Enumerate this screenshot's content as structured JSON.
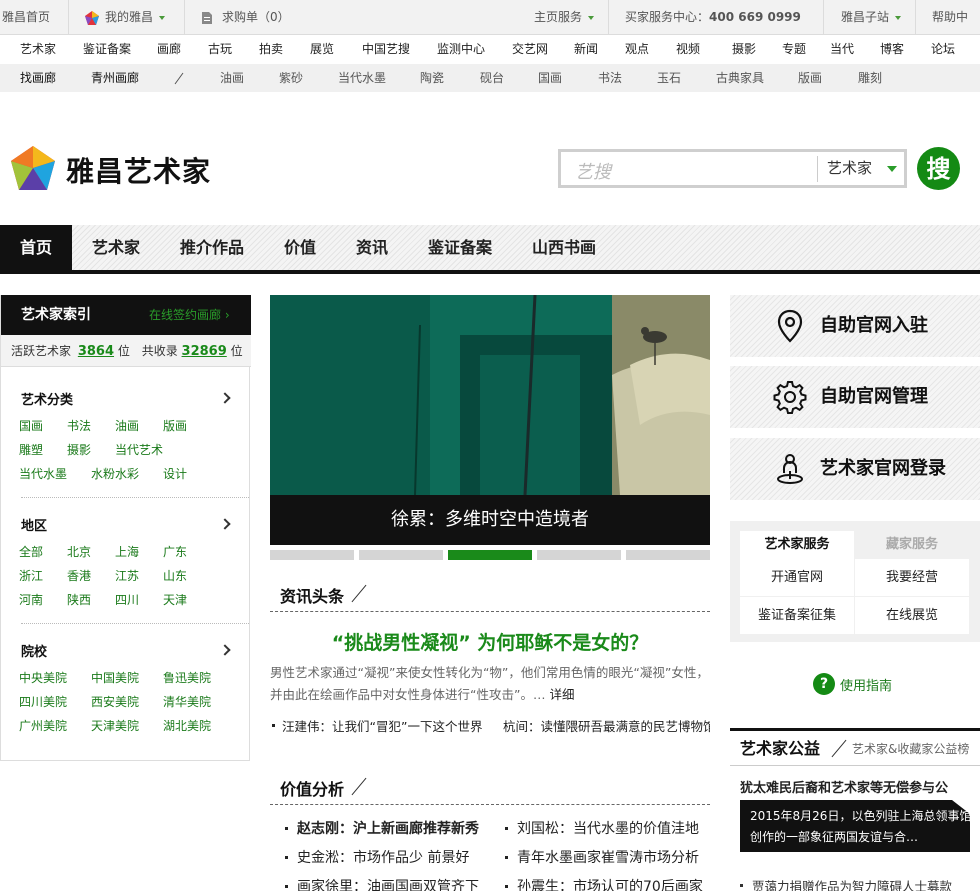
{
  "topbar": {
    "home": "雅昌首页",
    "my_artron": "我的雅昌",
    "cart": "求购单（0）",
    "main_services": "主页服务",
    "buyer_center": "买家服务中心：",
    "phone": "400 669 0999",
    "sub_sites": "雅昌子站",
    "help": "帮助中"
  },
  "nav1": [
    "艺术家",
    "鉴证备案",
    "画廊",
    "古玩",
    "拍卖",
    "展览",
    "中国艺搜",
    "监测中心",
    "交艺网",
    "新闻",
    "观点",
    "视频",
    "摄影",
    "专题",
    "当代",
    "博客",
    "论坛"
  ],
  "nav2": [
    "找画廊",
    "青州画廊",
    "油画",
    "紫砂",
    "当代水墨",
    "陶瓷",
    "砚台",
    "国画",
    "书法",
    "玉石",
    "古典家具",
    "版画",
    "雕刻"
  ],
  "header": {
    "brand": "雅昌艺术家",
    "search_placeholder": "艺搜",
    "search_category": "艺术家",
    "search_button": "搜"
  },
  "main_nav": [
    "首页",
    "艺术家",
    "推介作品",
    "价值",
    "资讯",
    "鉴证备案",
    "山西书画"
  ],
  "left_panel": {
    "title": "艺术家索引",
    "online_link": "在线签约画廊 ›",
    "active_label": "活跃艺术家",
    "active_count": "3864",
    "unit1": "位",
    "total_label": "共收录",
    "total_count": "32869",
    "unit2": "位",
    "sections": [
      {
        "title": "艺术分类",
        "items": [
          "国画",
          "书法",
          "油画",
          "版画",
          "雕塑",
          "摄影",
          "当代艺术",
          "当代水墨",
          "水粉水彩",
          "设计"
        ]
      },
      {
        "title": "地区",
        "items": [
          "全部",
          "北京",
          "上海",
          "广东",
          "浙江",
          "香港",
          "江苏",
          "山东",
          "河南",
          "陕西",
          "四川",
          "天津"
        ]
      },
      {
        "title": "院校",
        "items": [
          "中央美院",
          "中国美院",
          "鲁迅美院",
          "四川美院",
          "西安美院",
          "清华美院",
          "广州美院",
          "天津美院",
          "湖北美院"
        ]
      }
    ]
  },
  "slideshow": {
    "caption": "徐累：多维时空中造境者",
    "slide_count": 5,
    "active_index": 3
  },
  "news": {
    "heading": "资讯头条",
    "headline": "“挑战男性凝视” 为何耶稣不是女的？",
    "summary": "男性艺术家通过“凝视”来使女性转化为“物”，他们常用色情的眼光“凝视”女性，并由此在绘画作品中对女性身体进行“性攻击”。… ",
    "more": "详细",
    "bullets": [
      "汪建伟：让我们“冒犯”一下这个世界",
      "杭间：读懂隈研吾最满意的民艺博物馆"
    ]
  },
  "value": {
    "heading": "价值分析",
    "items": [
      {
        "text": "赵志刚：沪上新画廊推荐新秀",
        "bold": true
      },
      {
        "text": "刘国松：当代水墨的价值洼地",
        "bold": false
      },
      {
        "text": "史金淞：市场作品少 前景好",
        "bold": false
      },
      {
        "text": "青年水墨画家崔雪涛市场分析",
        "bold": false
      },
      {
        "text": "画家徐里：油画国画双管齐下",
        "bold": false
      },
      {
        "text": "孙震生：市场认可的70后画家",
        "bold": false
      }
    ]
  },
  "right": {
    "btn1": "自助官网入驻",
    "btn2": "自助官网管理",
    "btn3": "艺术家官网登录",
    "tab_active": "艺术家服务",
    "tab_inactive": "藏家服务",
    "cells": [
      "开通官网",
      "我要经营",
      "鉴证备案征集",
      "在线展览"
    ],
    "guide": "使用指南",
    "welfare_title": "艺术家公益",
    "welfare_sub": "艺术家&收藏家公益榜",
    "welfare_headline": "犹太难民后裔和艺术家等无偿参与公",
    "welfare_card_line1": "2015年8月26日，以色列驻上海总领事馆",
    "welfare_card_line2": "创作的一部象征两国友谊与合…",
    "welfare_item": "贾蔼力捐赠作品为智力障碍人士募款"
  },
  "colors": {
    "accent": "#1a8a1a",
    "dark": "#111111"
  }
}
